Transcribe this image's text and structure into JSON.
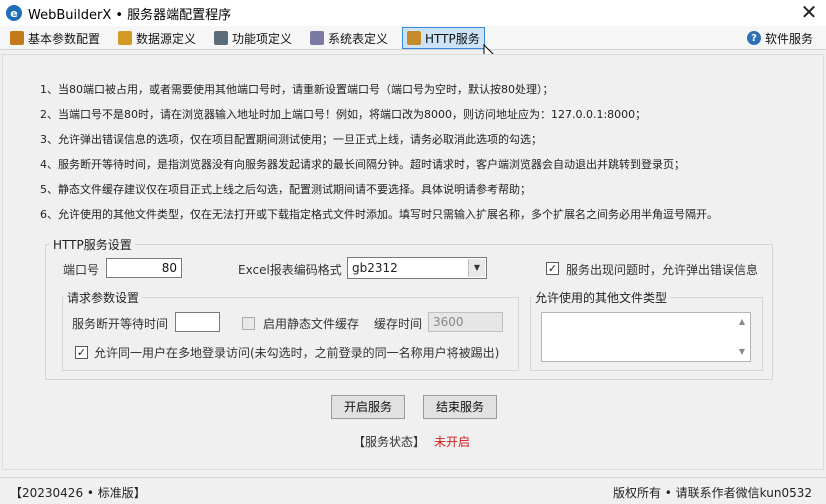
{
  "window": {
    "logo_glyph": "e",
    "title": "WebBuilderX • 服务器端配置程序",
    "close_glyph": "✕"
  },
  "toolbar": {
    "items": [
      {
        "label": "基本参数配置",
        "icon": "settings-icon",
        "color": "#c47a1a"
      },
      {
        "label": "数据源定义",
        "icon": "database-icon",
        "color": "#d39a26"
      },
      {
        "label": "功能项定义",
        "icon": "tools-icon",
        "color": "#5a6b7a"
      },
      {
        "label": "系统表定义",
        "icon": "wand-icon",
        "color": "#7a7aa3"
      },
      {
        "label": "HTTP服务",
        "icon": "http-service-icon",
        "color": "#c58a2a"
      }
    ],
    "help": {
      "label": "软件服务",
      "glyph": "?"
    }
  },
  "notes": [
    "1、当80端口被占用，或者需要使用其他端口号时，请重新设置端口号（端口号为空时，默认按80处理）；",
    "2、当端口号不是80时，请在浏览器输入地址时加上端口号！例如，将端口改为8000，则访问地址应为：127.0.0.1:8000；",
    "3、允许弹出错误信息的选项，仅在项目配置期间测试使用；一旦正式上线，请务必取消此选项的勾选；",
    "4、服务断开等待时间，是指浏览器没有向服务器发起请求的最长间隔分钟。超时请求时，客户端浏览器会自动退出并跳转到登录页；",
    "5、静态文件缓存建议仅在项目正式上线之后勾选，配置测试期间请不要选择。具体说明请参考帮助；",
    "6、允许使用的其他文件类型，仅在无法打开或下载指定格式文件时添加。填写时只需输入扩展名称，多个扩展名之间务必用半角逗号隔开。"
  ],
  "http_settings": {
    "group_title": "HTTP服务设置",
    "port_label": "端口号",
    "port_value": "80",
    "excel_label": "Excel报表编码格式",
    "excel_value": "gb2312",
    "combo_arrow": "▼",
    "allow_error_label": "服务出现问题时，允许弹出错误信息",
    "allow_error_checked": true,
    "check_glyph": "✓"
  },
  "request_settings": {
    "group_title": "请求参数设置",
    "timeout_label": "服务断开等待时间",
    "timeout_value": "",
    "static_cache_label": "启用静态文件缓存",
    "static_cache_checked": false,
    "cache_time_label": "缓存时间",
    "cache_time_value": "3600",
    "multi_login_label": "允许同一用户在多地登录访问(未勾选时，之前登录的同一名称用户将被踢出)",
    "multi_login_checked": true
  },
  "file_types": {
    "group_title": "允许使用的其他文件类型",
    "value": "",
    "scroll_up": "▲",
    "scroll_down": "▼"
  },
  "buttons": {
    "start": "开启服务",
    "stop": "结束服务"
  },
  "status": {
    "label": "【服务状态】",
    "value": "未开启"
  },
  "statusbar": {
    "version": "【20230426 • 标准版】",
    "copyright": "版权所有 • 请联系作者微信kun0532"
  }
}
